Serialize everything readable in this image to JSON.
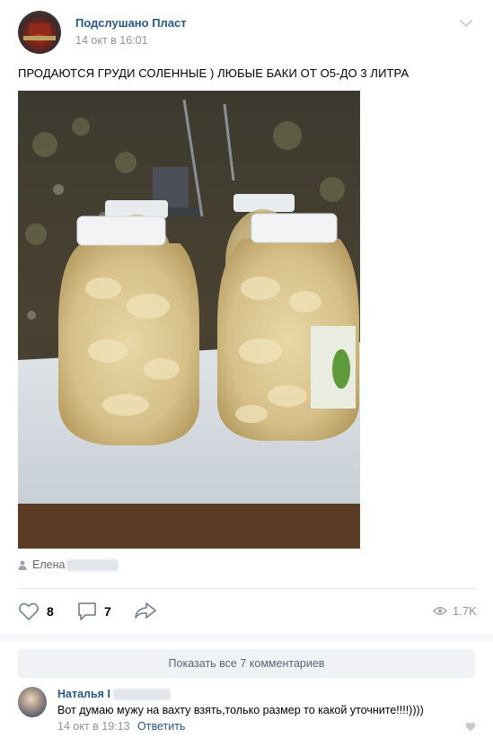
{
  "post": {
    "group_name": "Подслушано Пласт",
    "date": "14 окт в 16:01",
    "text": "ПРОДАЮТСЯ ГРУДИ СОЛЕННЫЕ ) ЛЮБЫЕ БАКИ ОТ О5-ДО 3 ЛИТРА",
    "author": "Елена",
    "likes": "8",
    "comments": "7",
    "views": "1.7K"
  },
  "comments_block": {
    "show_all_label": "Показать все 7 комментариев",
    "comment": {
      "author": "Наталья I",
      "text": "Вот думаю мужу на вахту взять,только размер то какой уточните!!!!))))",
      "time": "14 окт в 19:13",
      "reply_label": "Ответить"
    }
  },
  "icons": {
    "menu": "chevron-down-icon",
    "author": "person-icon",
    "like": "heart-icon",
    "comment": "comment-icon",
    "share": "share-icon",
    "views": "eye-icon"
  },
  "colors": {
    "link": "#2a5885",
    "muted": "#939393",
    "button_bg": "#f0f2f5"
  }
}
